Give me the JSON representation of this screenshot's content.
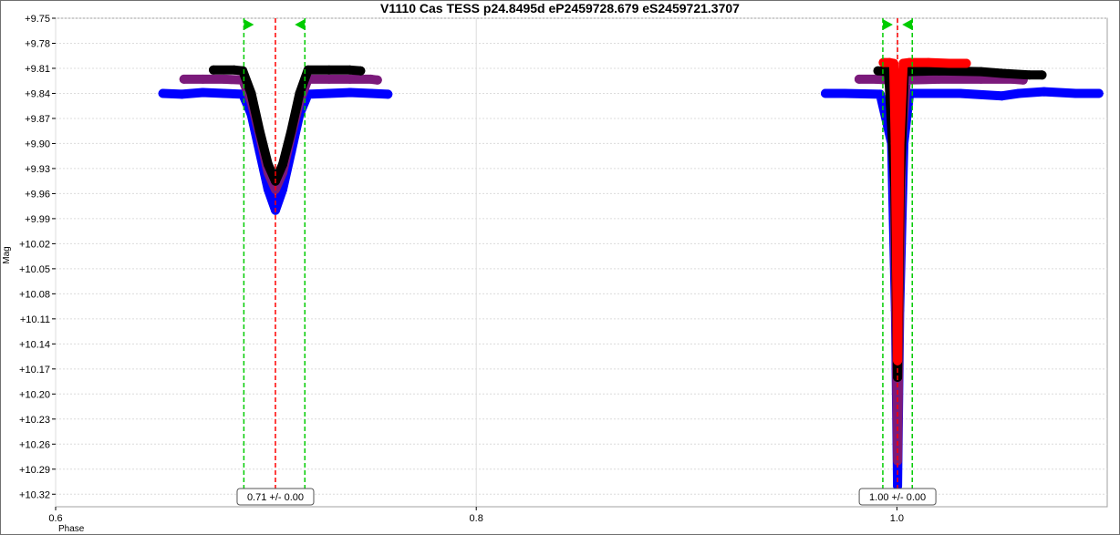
{
  "chart_data": {
    "type": "scatter",
    "title": "V1110 Cas TESS p24.8495d eP2459728.679 eS2459721.3707",
    "xlabel": "Phase",
    "ylabel": "Mag",
    "xlim": [
      0.6,
      1.1
    ],
    "ylim": [
      10.335,
      9.75
    ],
    "y_inverted": true,
    "grid": true,
    "x_ticks": [
      {
        "value": 0.6,
        "label": "0.6"
      },
      {
        "value": 0.8,
        "label": "0.8"
      },
      {
        "value": 1.0,
        "label": "1.0"
      }
    ],
    "y_ticks": [
      {
        "value": 9.75,
        "label": "+9.75"
      },
      {
        "value": 9.78,
        "label": "+9.78"
      },
      {
        "value": 9.81,
        "label": "+9.81"
      },
      {
        "value": 9.84,
        "label": "+9.84"
      },
      {
        "value": 9.87,
        "label": "+9.87"
      },
      {
        "value": 9.9,
        "label": "+9.90"
      },
      {
        "value": 9.93,
        "label": "+9.93"
      },
      {
        "value": 9.96,
        "label": "+9.96"
      },
      {
        "value": 9.99,
        "label": "+9.99"
      },
      {
        "value": 10.02,
        "label": "+10.02"
      },
      {
        "value": 10.05,
        "label": "+10.05"
      },
      {
        "value": 10.08,
        "label": "+10.08"
      },
      {
        "value": 10.11,
        "label": "+10.11"
      },
      {
        "value": 10.14,
        "label": "+10.14"
      },
      {
        "value": 10.17,
        "label": "+10.17"
      },
      {
        "value": 10.2,
        "label": "+10.20"
      },
      {
        "value": 10.23,
        "label": "+10.23"
      },
      {
        "value": 10.26,
        "label": "+10.26"
      },
      {
        "value": 10.29,
        "label": "+10.29"
      },
      {
        "value": 10.32,
        "label": "+10.32"
      }
    ],
    "series": [
      {
        "color": "#0000ff",
        "points": [
          [
            0.651,
            9.84
          ],
          [
            0.66,
            9.841
          ],
          [
            0.67,
            9.839
          ],
          [
            0.68,
            9.84
          ],
          [
            0.689,
            9.841
          ],
          [
            0.693,
            9.865
          ],
          [
            0.697,
            9.91
          ],
          [
            0.701,
            9.955
          ],
          [
            0.7045,
            9.98
          ],
          [
            0.708,
            9.955
          ],
          [
            0.712,
            9.91
          ],
          [
            0.716,
            9.865
          ],
          [
            0.72,
            9.841
          ],
          [
            0.73,
            9.84
          ],
          [
            0.74,
            9.839
          ],
          [
            0.75,
            9.84
          ],
          [
            0.758,
            9.841
          ],
          [
            0.966,
            9.84
          ],
          [
            0.975,
            9.84
          ],
          [
            0.992,
            9.841
          ],
          [
            0.9975,
            9.9
          ],
          [
            0.9993,
            10.1
          ],
          [
            1.0003,
            10.31
          ],
          [
            1.0013,
            10.1
          ],
          [
            1.0033,
            9.9
          ],
          [
            1.006,
            9.84
          ],
          [
            1.03,
            9.84
          ],
          [
            1.05,
            9.843
          ],
          [
            1.058,
            9.84
          ],
          [
            1.07,
            9.838
          ],
          [
            1.085,
            9.84
          ],
          [
            1.096,
            9.84
          ]
        ]
      },
      {
        "color": "#7b1a7b",
        "points": [
          [
            0.661,
            9.823
          ],
          [
            0.67,
            9.823
          ],
          [
            0.68,
            9.823
          ],
          [
            0.689,
            9.824
          ],
          [
            0.693,
            9.85
          ],
          [
            0.697,
            9.89
          ],
          [
            0.701,
            9.935
          ],
          [
            0.7045,
            9.955
          ],
          [
            0.708,
            9.935
          ],
          [
            0.712,
            9.89
          ],
          [
            0.716,
            9.85
          ],
          [
            0.72,
            9.823
          ],
          [
            0.73,
            9.823
          ],
          [
            0.74,
            9.823
          ],
          [
            0.75,
            9.823
          ],
          [
            0.753,
            9.824
          ],
          [
            0.982,
            9.823
          ],
          [
            0.99,
            9.823
          ],
          [
            0.997,
            9.824
          ],
          [
            0.9985,
            9.9
          ],
          [
            0.9995,
            10.1
          ],
          [
            1.0003,
            10.28
          ],
          [
            1.0011,
            10.1
          ],
          [
            1.0023,
            9.9
          ],
          [
            1.0045,
            9.824
          ],
          [
            1.02,
            9.823
          ],
          [
            1.04,
            9.823
          ],
          [
            1.055,
            9.823
          ],
          [
            1.06,
            9.824
          ]
        ]
      },
      {
        "color": "#000000",
        "points": [
          [
            0.675,
            9.812
          ],
          [
            0.685,
            9.812
          ],
          [
            0.689,
            9.813
          ],
          [
            0.693,
            9.84
          ],
          [
            0.697,
            9.885
          ],
          [
            0.701,
            9.925
          ],
          [
            0.7045,
            9.945
          ],
          [
            0.708,
            9.925
          ],
          [
            0.712,
            9.885
          ],
          [
            0.716,
            9.84
          ],
          [
            0.72,
            9.812
          ],
          [
            0.73,
            9.812
          ],
          [
            0.74,
            9.812
          ],
          [
            0.745,
            9.813
          ],
          [
            0.991,
            9.813
          ],
          [
            0.996,
            9.814
          ],
          [
            0.999,
            9.95
          ],
          [
            1.0003,
            10.18
          ],
          [
            1.0015,
            9.95
          ],
          [
            1.0035,
            9.814
          ],
          [
            1.02,
            9.813
          ],
          [
            1.04,
            9.814
          ],
          [
            1.05,
            9.816
          ],
          [
            1.063,
            9.818
          ],
          [
            1.069,
            9.818
          ]
        ]
      },
      {
        "color": "#ff0000",
        "points": [
          [
            0.9935,
            9.803
          ],
          [
            0.9965,
            9.803
          ],
          [
            0.9985,
            9.804
          ],
          [
            0.9992,
            9.9
          ],
          [
            1.0003,
            10.16
          ],
          [
            1.0014,
            9.9
          ],
          [
            1.003,
            9.804
          ],
          [
            1.006,
            9.803
          ],
          [
            1.015,
            9.803
          ],
          [
            1.025,
            9.804
          ],
          [
            1.033,
            9.804
          ]
        ]
      }
    ],
    "markers": [
      {
        "label": "0.71 +/- 0.00",
        "center": 0.7045,
        "lower": 0.6895,
        "upper": 0.7185
      },
      {
        "label": "1.00 +/- 0.00",
        "center": 1.0003,
        "lower": 0.9933,
        "upper": 1.0073
      }
    ],
    "colors": {
      "center_line": "#ff0000",
      "bound_line": "#00cc00",
      "grid": "#dcdcdc"
    }
  }
}
